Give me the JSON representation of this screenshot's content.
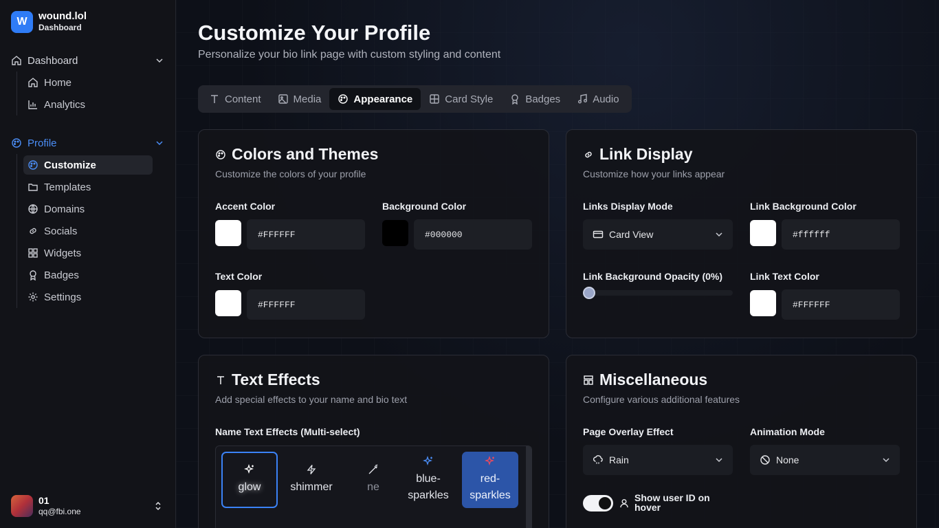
{
  "brand": {
    "logo_letter": "W",
    "name": "wound.lol",
    "sub": "Dashboard"
  },
  "sidebar": {
    "dashboard_group": {
      "label": "Dashboard",
      "items": [
        {
          "label": "Home",
          "icon": "home-icon"
        },
        {
          "label": "Analytics",
          "icon": "chart-icon"
        }
      ]
    },
    "profile_group": {
      "label": "Profile",
      "items": [
        {
          "label": "Customize",
          "icon": "palette-icon",
          "active": true
        },
        {
          "label": "Templates",
          "icon": "folder-icon"
        },
        {
          "label": "Domains",
          "icon": "globe-icon"
        },
        {
          "label": "Socials",
          "icon": "link-icon"
        },
        {
          "label": "Widgets",
          "icon": "grid-icon"
        },
        {
          "label": "Badges",
          "icon": "award-icon"
        },
        {
          "label": "Settings",
          "icon": "gear-icon"
        }
      ]
    }
  },
  "user": {
    "name": "01",
    "email": "qq@fbi.one"
  },
  "header": {
    "title": "Customize Your Profile",
    "subtitle": "Personalize your bio link page with custom styling and content"
  },
  "tabs": [
    {
      "label": "Content",
      "icon": "text-icon"
    },
    {
      "label": "Media",
      "icon": "image-icon"
    },
    {
      "label": "Appearance",
      "icon": "palette-icon",
      "active": true
    },
    {
      "label": "Card Style",
      "icon": "table-icon"
    },
    {
      "label": "Badges",
      "icon": "award-icon"
    },
    {
      "label": "Audio",
      "icon": "music-icon"
    }
  ],
  "colors_card": {
    "title": "Colors and Themes",
    "desc": "Customize the colors of your profile",
    "accent_label": "Accent Color",
    "accent_value": "#FFFFFF",
    "background_label": "Background Color",
    "background_value": "#000000",
    "text_label": "Text Color",
    "text_value": "#FFFFFF"
  },
  "link_card": {
    "title": "Link Display",
    "desc": "Customize how your links appear",
    "mode_label": "Links Display Mode",
    "mode_value": "Card View",
    "bg_color_label": "Link Background Color",
    "bg_color_value": "#ffffff",
    "opacity_label": "Link Background Opacity (0%)",
    "opacity_value": 0,
    "text_color_label": "Link Text Color",
    "text_color_value": "#FFFFFF"
  },
  "effects_card": {
    "title": "Text Effects",
    "desc": "Add special effects to your name and bio text",
    "name_effects_label": "Name Text Effects (Multi-select)",
    "effects": [
      {
        "label": "glow",
        "icon": "sparkles-icon"
      },
      {
        "label": "shimmer",
        "icon": "zap-icon"
      },
      {
        "label": "ne",
        "icon": "wand-icon"
      },
      {
        "label": "blue-sparkles",
        "icon": "sparkles-icon"
      },
      {
        "label": "red-sparkles",
        "icon": "sparkles-icon"
      }
    ]
  },
  "misc_card": {
    "title": "Miscellaneous",
    "desc": "Configure various additional features",
    "overlay_label": "Page Overlay Effect",
    "overlay_value": "Rain",
    "animation_label": "Animation Mode",
    "animation_value": "None",
    "userid_label": "Show user ID on hover",
    "userid_enabled": true
  },
  "theme": {
    "accent": "#3b82f6",
    "selected_fill": "#2c55a8",
    "blue_sparkle": "#4b8ef7",
    "red_sparkle": "#f04a5c"
  }
}
